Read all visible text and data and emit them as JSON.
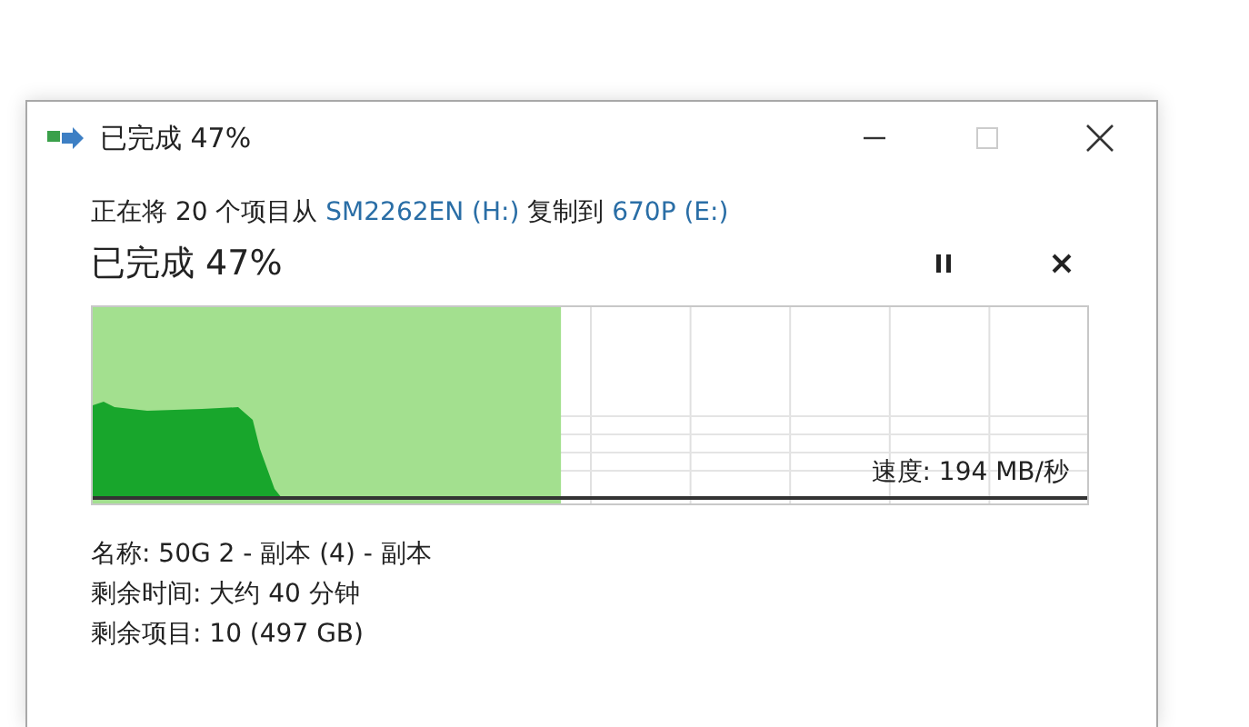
{
  "window": {
    "title": "已完成 47%"
  },
  "description": [
    {
      "kind": "text",
      "text": "正在将 20 个项目从 "
    },
    {
      "kind": "link",
      "text": "SM2262EN (H:)"
    },
    {
      "kind": "text",
      "text": " 复制到 "
    },
    {
      "kind": "link",
      "text": "670P (E:)"
    }
  ],
  "progress": {
    "heading": "已完成 47%",
    "level": 0.47,
    "speed": "速度: 194 MB/秒"
  },
  "details": [
    "名称: 50G 2 - 副本 (4) - 副本",
    "剩余时间: 大约 40 分钟",
    "剩余项目: 10 (497 GB)"
  ]
}
